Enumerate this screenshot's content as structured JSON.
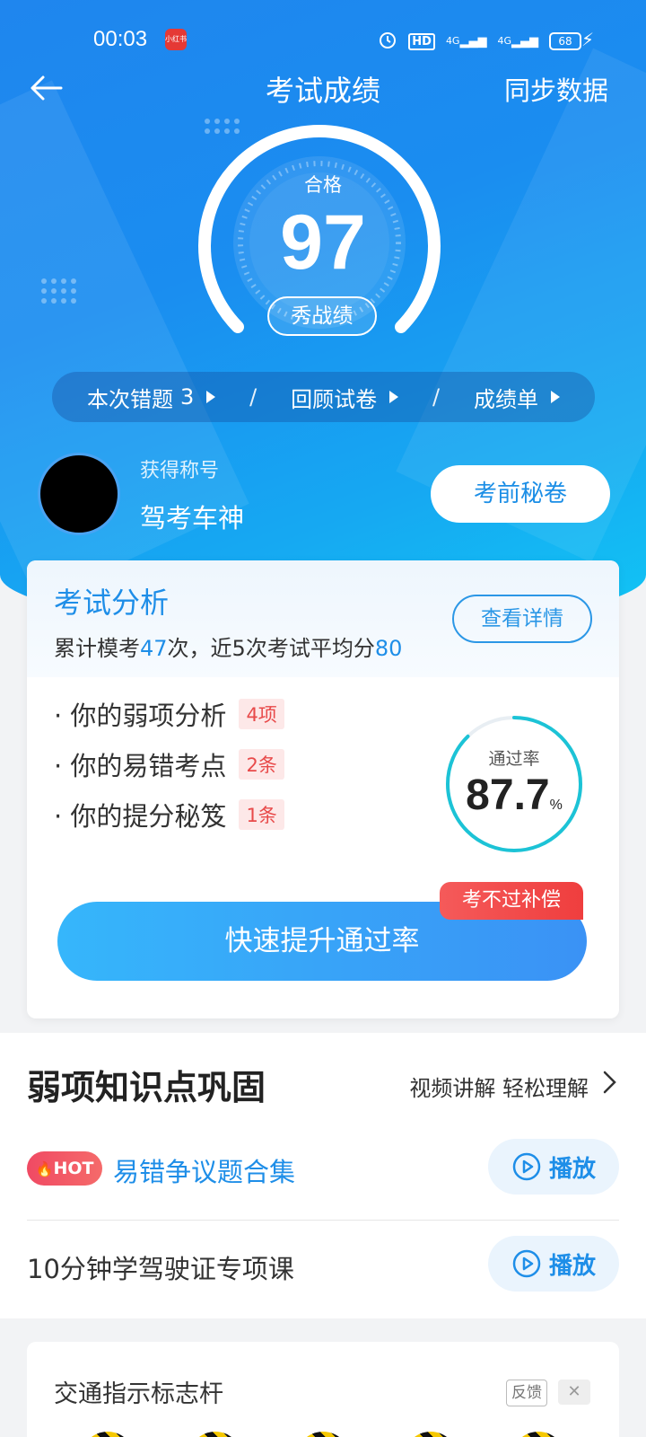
{
  "status_bar": {
    "time": "00:03",
    "app_badge": "小红书",
    "hd": "HD",
    "net1": "4G",
    "net2": "4G",
    "battery": "68"
  },
  "nav": {
    "title": "考试成绩",
    "sync_label": "同步数据"
  },
  "gauge": {
    "label": "合格",
    "score": "97",
    "show_button": "秀战绩"
  },
  "actions": {
    "wrong_label": "本次错题",
    "wrong_count": "3",
    "sep": "/",
    "review_label": "回顾试卷",
    "report_label": "成绩单"
  },
  "profile": {
    "title_label": "获得称号",
    "title_value": "驾考车神",
    "secret_button": "考前秘卷"
  },
  "analysis": {
    "title": "考试分析",
    "summary_pre": "累计模考",
    "exam_count": "47",
    "summary_mid": "次，近5次考试平均分",
    "avg_score": "80",
    "detail_button": "查看详情",
    "items": [
      {
        "label": "· 你的弱项分析",
        "tag": "4项"
      },
      {
        "label": "· 你的易错考点",
        "tag": "2条"
      },
      {
        "label": "· 你的提分秘笈",
        "tag": "1条"
      }
    ],
    "pass_label": "通过率",
    "pass_rate": "87.7",
    "pass_unit": "%",
    "pass_rate_fraction": 0.877,
    "compensate_badge": "考不过补偿",
    "boost_button": "快速提升通过率"
  },
  "weak": {
    "title": "弱项知识点巩固",
    "more": "视频讲解 轻松理解",
    "rows": [
      {
        "hot": "HOT",
        "text": "易错争议题合集",
        "play": "播放"
      },
      {
        "text": "10分钟学驾驶证专项课",
        "play": "播放"
      }
    ]
  },
  "traffic": {
    "title": "交通指示标志杆",
    "feedback": "反馈",
    "close": "✕"
  },
  "colors": {
    "accent": "#1e8ee8",
    "hero_start": "#1f86ee",
    "hero_end": "#11c6f4",
    "tag_red": "#e84a4a"
  }
}
